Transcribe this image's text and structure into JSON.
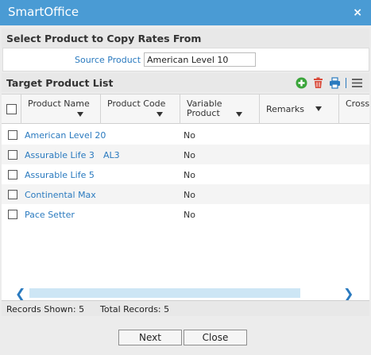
{
  "window": {
    "title": "SmartOffice",
    "close_glyph": "×"
  },
  "source_section": {
    "title": "Select Product to Copy Rates From",
    "source_label": "Source Product",
    "source_value": "American Level 10"
  },
  "target_section": {
    "title": "Target Product List",
    "toolbar_icons": [
      "add-icon",
      "delete-icon",
      "print-icon",
      "columns-menu-icon"
    ]
  },
  "grid": {
    "columns": [
      {
        "label": "Product Name"
      },
      {
        "label": "Product Code"
      },
      {
        "label": "Variable Product"
      },
      {
        "label": "Remarks"
      },
      {
        "label": "Cross"
      }
    ],
    "rows": [
      {
        "name": "American Level 20",
        "code": "",
        "variable": "No"
      },
      {
        "name": "Assurable Life 3",
        "code": "AL3",
        "variable": "No"
      },
      {
        "name": "Assurable Life 5",
        "code": "",
        "variable": "No"
      },
      {
        "name": "Continental Max",
        "code": "",
        "variable": "No"
      },
      {
        "name": "Pace Setter",
        "code": "",
        "variable": "No"
      }
    ]
  },
  "status": {
    "records_shown": "Records Shown: 5",
    "total_records": "Total Records: 5"
  },
  "buttons": {
    "next": "Next",
    "close": "Close"
  },
  "colors": {
    "titlebar": "#4a9bd4",
    "link": "#2a7abf",
    "add": "#3aa53a",
    "delete": "#d94a3a"
  }
}
